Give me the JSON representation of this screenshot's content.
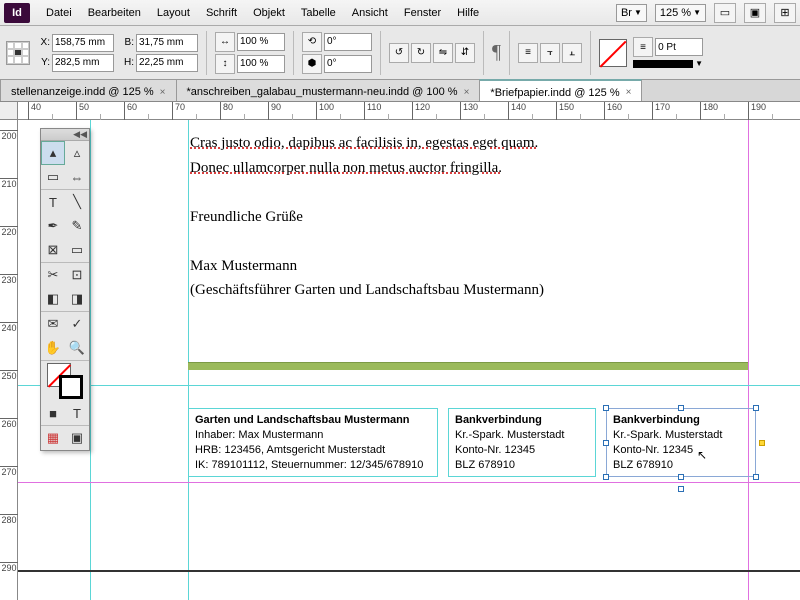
{
  "app": {
    "icon": "Id"
  },
  "menu": [
    "Datei",
    "Bearbeiten",
    "Layout",
    "Schrift",
    "Objekt",
    "Tabelle",
    "Ansicht",
    "Fenster",
    "Hilfe"
  ],
  "menubar_controls": {
    "br_label": "Br",
    "zoom": "125 %"
  },
  "controlbar": {
    "x": "158,75 mm",
    "y": "282,5 mm",
    "b": "31,75 mm",
    "h": "22,25 mm",
    "scale_x": "100 %",
    "scale_y": "100 %",
    "rotate": "0°",
    "shear": "0°",
    "stroke_weight": "0 Pt"
  },
  "tabs": [
    {
      "label": "stellenanzeige.indd @ 125 %",
      "active": false
    },
    {
      "label": "*anschreiben_galabau_mustermann-neu.indd @ 100 %",
      "active": false
    },
    {
      "label": "*Briefpapier.indd @ 125 %",
      "active": true
    }
  ],
  "ruler_h": [
    40,
    50,
    60,
    70,
    80,
    90,
    100,
    110,
    120,
    130,
    140,
    150,
    160,
    170,
    180,
    190
  ],
  "ruler_v": [
    200,
    210,
    220,
    230,
    240,
    250,
    260,
    270,
    280,
    290
  ],
  "doc": {
    "line1a": "Cras justo odio, dapibus ac facilisis in, egestas eget quam.",
    "line1b": "Donec ullamcorper nulla non metus auctor fringilla.",
    "greeting": "Freundliche Grüße",
    "name": "Max Mustermann",
    "role": "(Geschäftsführer Garten und Landschaftsbau Mustermann)"
  },
  "footer1": {
    "head": "Garten und Landschaftsbau Mustermann",
    "l1": "Inhaber: Max Mustermann",
    "l2": "HRB: 123456, Amtsgericht Musterstadt",
    "l3": "IK: 789101112, Steuernummer: 12/345/678910"
  },
  "footer2": {
    "head": "Bankverbindung",
    "l1": "Kr.-Spark. Musterstadt",
    "l2": "Konto-Nr. 12345",
    "l3": "BLZ 678910"
  },
  "footer3": {
    "head": "Bankverbindung",
    "l1": "Kr.-Spark. Musterstadt",
    "l2": "Konto-Nr. 12345",
    "l3": "BLZ 678910"
  }
}
